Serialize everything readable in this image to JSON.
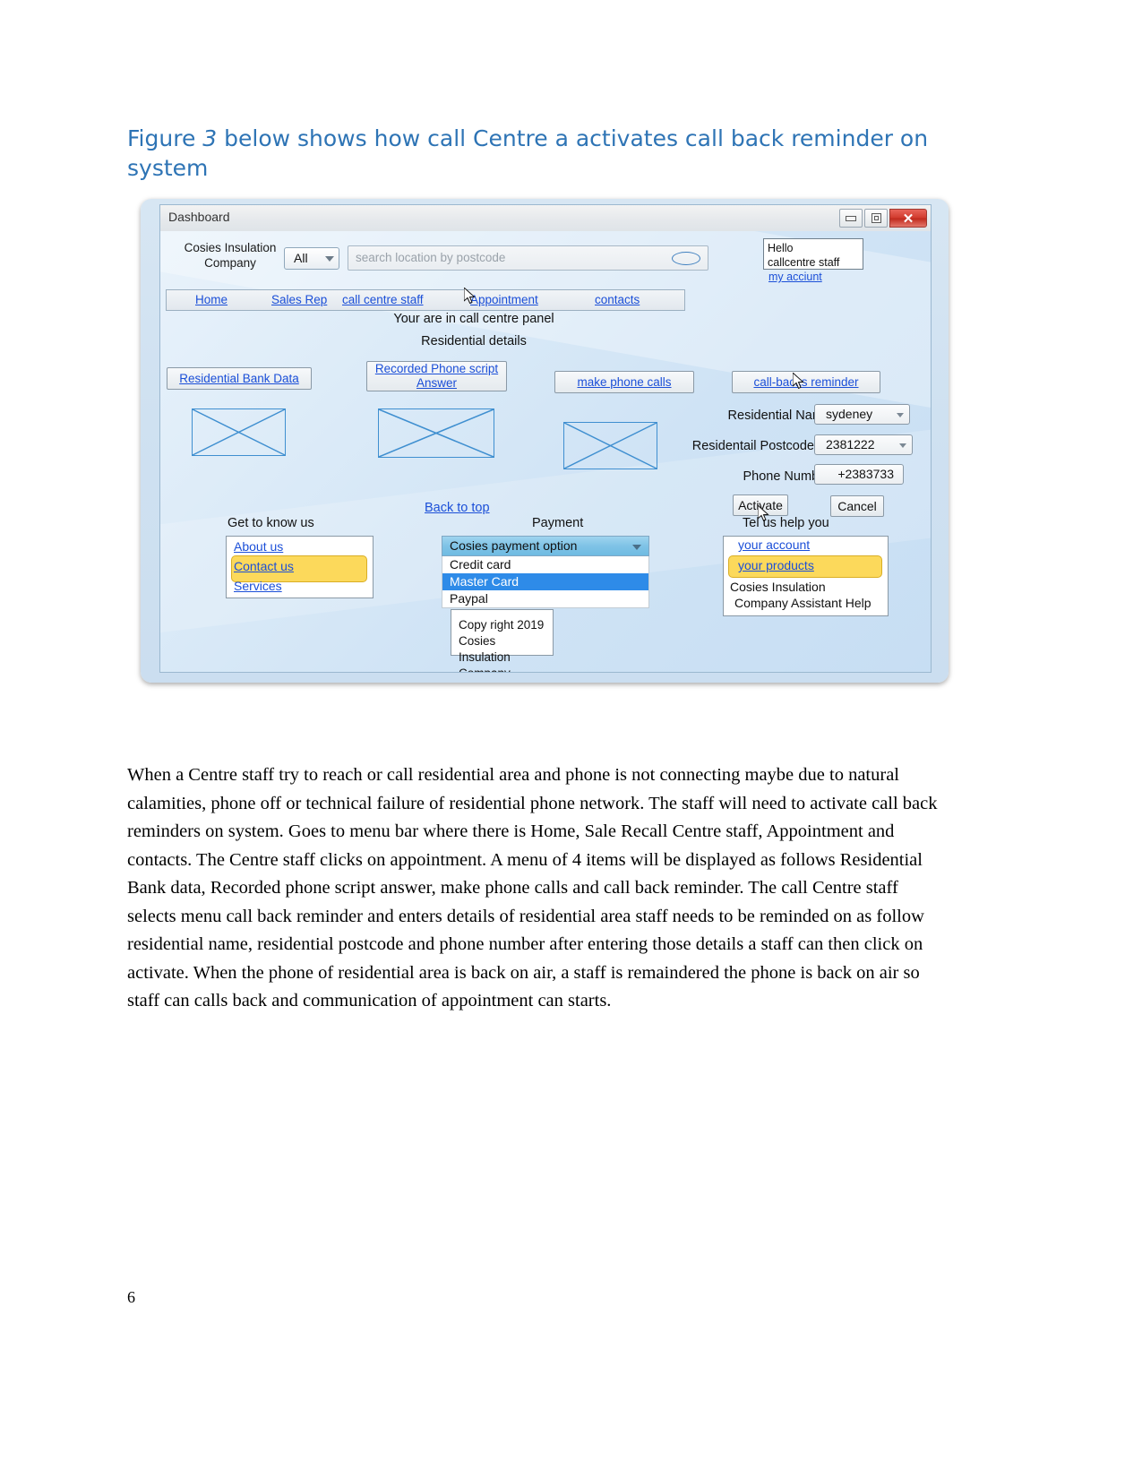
{
  "document": {
    "heading_pre": "Figure ",
    "heading_italic": "3",
    "heading_post": " below shows how call Centre a activates call back reminder on system",
    "page_number": "6",
    "body_paragraph": "When a Centre staff try to reach or call residential area and phone is not connecting maybe due to natural calamities, phone off or technical failure of residential phone network. The staff will need to activate call back reminders on system. Goes to menu bar where there is Home, Sale Recall Centre staff, Appointment and contacts. The Centre staff clicks on appointment. A menu of 4 items will be displayed as follows Residential Bank data, Recorded phone script answer, make phone calls and call back reminder. The call Centre staff selects menu call back reminder and enters details of residential area staff needs to be reminded on as follow residential name, residential postcode and phone number after entering those details a staff can then click on activate. When the phone of residential area is back on air, a staff is remaindered  the phone is back on air so staff  can calls back and communication  of appointment can starts."
  },
  "mockup": {
    "titlebar": {
      "title": "Dashboard",
      "minimize_label": "minimize",
      "maximize_label": "maximize",
      "close_label": "✕"
    },
    "header": {
      "brand_line1": "Cosies Insulation",
      "brand_line2": "Company",
      "category_value": "All",
      "search_placeholder": "search location by postcode",
      "hello_line1": "Hello",
      "hello_line2": "callcentre staff",
      "my_account_link": "my acciunt"
    },
    "nav": {
      "items": [
        {
          "label": "Home"
        },
        {
          "label": "Sales Rep"
        },
        {
          "label": "call centre staff"
        },
        {
          "label": "Appointment"
        },
        {
          "label": "contacts"
        }
      ]
    },
    "panel": {
      "status_line": "Your are in call centre panel",
      "section_title": "Residential details"
    },
    "actions": [
      {
        "label": "Residential Bank Data"
      },
      {
        "label": "Recorded Phone script Answer"
      },
      {
        "label": "make phone calls"
      },
      {
        "label": "call-backs reminder"
      }
    ],
    "form": {
      "rows": [
        {
          "label": "Residential Name",
          "value": "sydeney",
          "has_dropdown": true
        },
        {
          "label": "Residentail Postcode",
          "value": "2381222",
          "has_dropdown": true
        },
        {
          "label": "Phone Number",
          "value": "+2383733",
          "has_dropdown": false
        }
      ],
      "activate_label": "Activate",
      "cancel_label": "Cancel"
    },
    "footer": {
      "back_to_top": "Back to top",
      "get_to_know_title": "Get to know us",
      "get_to_know_links": [
        "About us",
        "Contact us",
        "Services"
      ],
      "get_to_know_highlighted": "Contact us",
      "payment_title": "Payment",
      "payment_combo_label": "Cosies payment option",
      "payment_options": [
        "Credit card",
        "Master Card",
        "Paypal"
      ],
      "payment_selected": "Master Card",
      "help_title": "Tel us help you",
      "help_links": [
        "your account",
        "your products"
      ],
      "help_highlighted": "your products",
      "help_text_line1": "Cosies Insulation",
      "help_text_line2": "Company Assistant Help",
      "copyright_line1": "Copy right 2019 Cosies",
      "copyright_line2": "Insulation Company"
    },
    "colors": {
      "link": "#1b4fd8",
      "heading": "#2E74B5",
      "highlight_yellow": "#FCD95B",
      "selected_blue": "#2E8BE8",
      "combo_blue": "#7fc3e6",
      "close_red": "#d13b2e"
    }
  }
}
